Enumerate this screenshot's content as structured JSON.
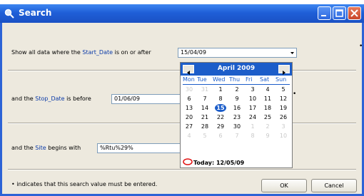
{
  "window": {
    "title": "Search"
  },
  "rows": {
    "start": {
      "prefix": "Show all data where the",
      "field": "Start_Date",
      "suffix": "is on or after",
      "value": "15/04/09"
    },
    "stop": {
      "prefix": "and the",
      "field": "Stop_Date",
      "suffix": "is before",
      "value": "01/06/09"
    },
    "site": {
      "prefix": "and the",
      "field": "Site",
      "suffix": "begins with",
      "value": "%Rtu%29%"
    }
  },
  "bullet_glyph": "•",
  "footer": {
    "note": "indicates that this search value must be entered.",
    "ok_label": "OK",
    "cancel_label": "Cancel"
  },
  "calendar": {
    "month_label": "April 2009",
    "weekdays": [
      "Mon",
      "Tue",
      "Wed",
      "Thu",
      "Fri",
      "Sat",
      "Sun"
    ],
    "weeks": [
      [
        "30",
        "31",
        "1",
        "2",
        "3",
        "4",
        "5"
      ],
      [
        "6",
        "7",
        "8",
        "9",
        "10",
        "11",
        "12"
      ],
      [
        "13",
        "14",
        "15",
        "16",
        "17",
        "18",
        "19"
      ],
      [
        "20",
        "21",
        "22",
        "23",
        "24",
        "25",
        "26"
      ],
      [
        "27",
        "28",
        "29",
        "30",
        "1",
        "2",
        "3"
      ],
      [
        "4",
        "5",
        "6",
        "7",
        "8",
        "9",
        "10"
      ]
    ],
    "selected_day": "15",
    "today_label": "Today: 12/05/09"
  },
  "colors": {
    "title_bar": "#1f5fd8",
    "dialog_bg": "#ede9de",
    "calendar_header": "#1c5dc9",
    "field_name": "#0a3aa8"
  },
  "icons": [
    "search-icon",
    "minimize-icon",
    "maximize-icon",
    "close-icon",
    "dropdown-arrow-icon",
    "prev-month-icon",
    "next-month-icon",
    "today-circle-icon"
  ]
}
